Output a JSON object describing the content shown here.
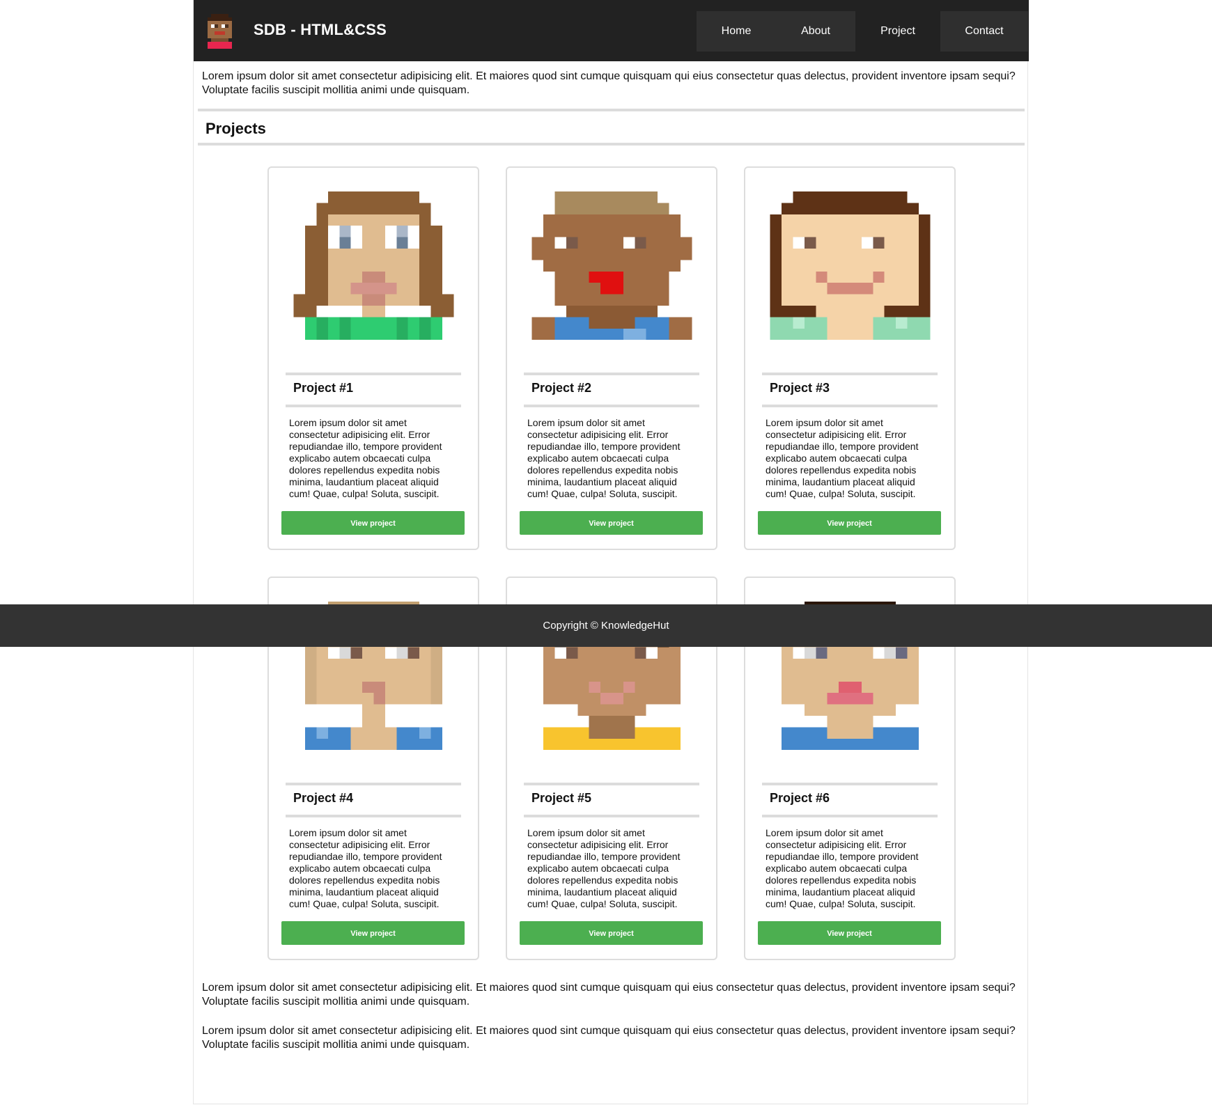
{
  "header": {
    "brand": "SDB - HTML&CSS",
    "nav": [
      "Home",
      "About",
      "Project",
      "Contact"
    ]
  },
  "intro": "Lorem ipsum dolor sit amet consectetur adipisicing elit. Et maiores quod sint cumque quisquam qui eius consectetur quas delectus, provident inventore ipsam sequi? Voluptate facilis suscipit mollitia animi unde quisquam.",
  "section_title": "Projects",
  "projects": [
    {
      "title": "Project #1",
      "description": "Lorem ipsum dolor sit amet consectetur adipisicing elit. Error repudiandae illo, tempore provident explicabo autem obcaecati culpa dolores repellendus expedita nobis minima, laudantium placeat aliquid cum! Quae, culpa! Soluta, suscipit.",
      "button": "View project",
      "avatar": "avatar-1"
    },
    {
      "title": "Project #2",
      "description": "Lorem ipsum dolor sit amet consectetur adipisicing elit. Error repudiandae illo, tempore provident explicabo autem obcaecati culpa dolores repellendus expedita nobis minima, laudantium placeat aliquid cum! Quae, culpa! Soluta, suscipit.",
      "button": "View project",
      "avatar": "avatar-2"
    },
    {
      "title": "Project #3",
      "description": "Lorem ipsum dolor sit amet consectetur adipisicing elit. Error repudiandae illo, tempore provident explicabo autem obcaecati culpa dolores repellendus expedita nobis minima, laudantium placeat aliquid cum! Quae, culpa! Soluta, suscipit.",
      "button": "View project",
      "avatar": "avatar-3"
    },
    {
      "title": "Project #4",
      "description": "Lorem ipsum dolor sit amet consectetur adipisicing elit. Error repudiandae illo, tempore provident explicabo autem obcaecati culpa dolores repellendus expedita nobis minima, laudantium placeat aliquid cum! Quae, culpa! Soluta, suscipit.",
      "button": "View project",
      "avatar": "avatar-4"
    },
    {
      "title": "Project #5",
      "description": "Lorem ipsum dolor sit amet consectetur adipisicing elit. Error repudiandae illo, tempore provident explicabo autem obcaecati culpa dolores repellendus expedita nobis minima, laudantium placeat aliquid cum! Quae, culpa! Soluta, suscipit.",
      "button": "View project",
      "avatar": "avatar-5"
    },
    {
      "title": "Project #6",
      "description": "Lorem ipsum dolor sit amet consectetur adipisicing elit. Error repudiandae illo, tempore provident explicabo autem obcaecati culpa dolores repellendus expedita nobis minima, laudantium placeat aliquid cum! Quae, culpa! Soluta, suscipit.",
      "button": "View project",
      "avatar": "avatar-6"
    }
  ],
  "outro": [
    "Lorem ipsum dolor sit amet consectetur adipisicing elit. Et maiores quod sint cumque quisquam qui eius consectetur quas delectus, provident inventore ipsam sequi? Voluptate facilis suscipit mollitia animi unde quisquam.",
    "Lorem ipsum dolor sit amet consectetur adipisicing elit. Et maiores quod sint cumque quisquam qui eius consectetur quas delectus, provident inventore ipsam sequi? Voluptate facilis suscipit mollitia animi unde quisquam."
  ],
  "footer": "Copyright © KnowledgeHut",
  "colors": {
    "header_bg": "#222222",
    "button_green": "#4caf50",
    "footer_bg": "#333333"
  }
}
